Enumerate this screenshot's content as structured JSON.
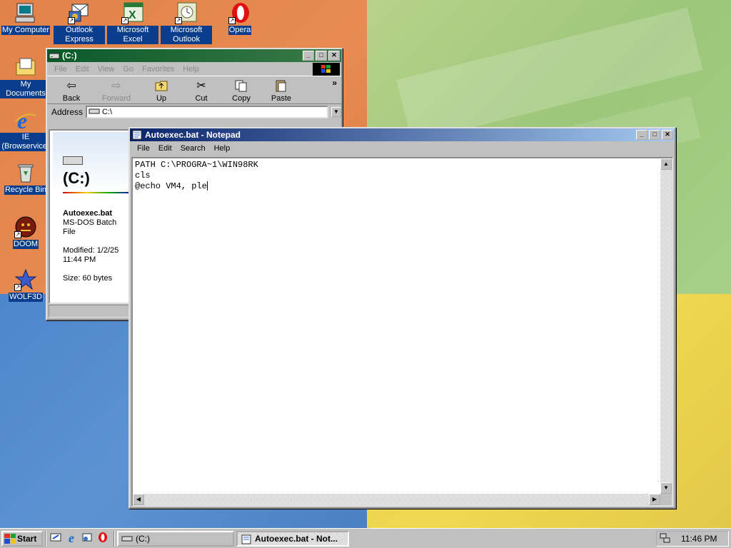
{
  "desktop": {
    "icons": [
      {
        "label": "My Computer",
        "icon": "my-computer-icon"
      },
      {
        "label": "Outlook Express",
        "icon": "outlook-express-icon"
      },
      {
        "label": "Microsoft Excel",
        "icon": "excel-icon"
      },
      {
        "label": "Microsoft Outlook",
        "icon": "outlook-icon"
      },
      {
        "label": "Opera",
        "icon": "opera-icon"
      },
      {
        "label": "My Documents",
        "icon": "folder-icon"
      },
      {
        "label": "IE (Browservice)",
        "icon": "internet-explorer-icon"
      },
      {
        "label": "Recycle Bin",
        "icon": "recycle-bin-icon"
      },
      {
        "label": "DOOM",
        "icon": "doom-icon"
      },
      {
        "label": "WOLF3D",
        "icon": "wolf3d-icon"
      }
    ]
  },
  "explorer": {
    "title": "(C:)",
    "menu": [
      "File",
      "Edit",
      "View",
      "Go",
      "Favorites",
      "Help"
    ],
    "toolbar": [
      "Back",
      "Forward",
      "Up",
      "Cut",
      "Copy",
      "Paste"
    ],
    "toolbar_more": "»",
    "address_label": "Address",
    "address_value": "C:\\",
    "panel": {
      "drive": "(C:)",
      "file_name": "Autoexec.bat",
      "file_type": "MS-DOS Batch File",
      "modified": "Modified: 1/2/25 11:44 PM",
      "size": "Size: 60 bytes"
    }
  },
  "notepad": {
    "title": "Autoexec.bat - Notepad",
    "menu": [
      "File",
      "Edit",
      "Search",
      "Help"
    ],
    "content": [
      "PATH C:\\PROGRA~1\\WIN98RK",
      "cls",
      "@echo VM4, ple"
    ]
  },
  "taskbar": {
    "start_label": "Start",
    "tasks": [
      {
        "label": "(C:)"
      },
      {
        "label": "Autoexec.bat - Not..."
      }
    ],
    "clock": "11:46 PM"
  },
  "colors": {
    "active_title": "#0a246a",
    "desktop_label_bg": "#0a3d8c",
    "window_face": "#c0c0c0"
  }
}
